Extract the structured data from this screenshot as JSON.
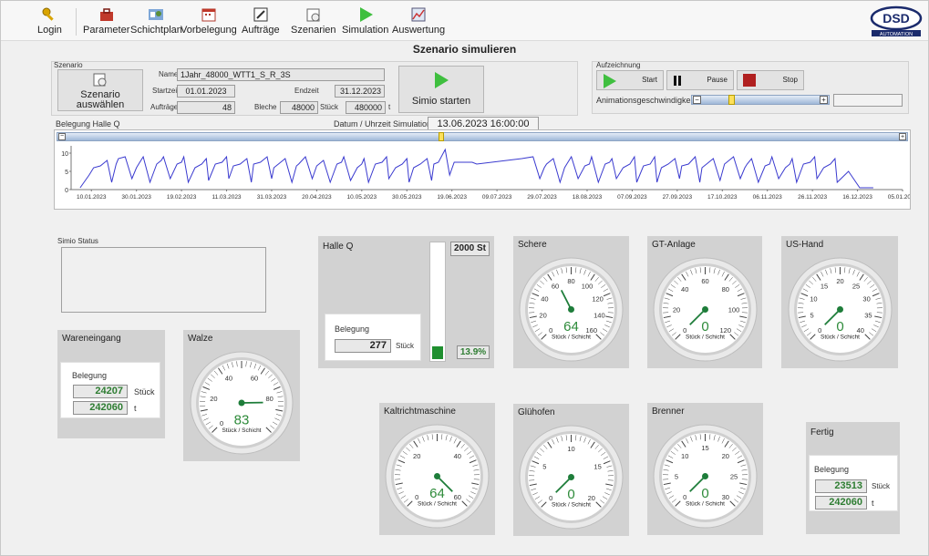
{
  "toolbar": {
    "login": "Login",
    "parameter": "Parameter",
    "schichtplan": "Schichtplan",
    "vorbelegung": "Vorbelegung",
    "auftraege": "Aufträge",
    "szenarien": "Szenarien",
    "simulation": "Simulation",
    "auswertung": "Auswertung"
  },
  "logo": {
    "top": "DSD",
    "bottom": "AUTOMATION"
  },
  "page_title": "Szenario simulieren",
  "szenario": {
    "group_label": "Szenario",
    "select_button": "Szenario auswählen",
    "name_label": "Name",
    "name_value": "1Jahr_48000_WTT1_S_R_3S",
    "startzeit_label": "Startzeit",
    "startzeit_value": "01.01.2023",
    "endzeit_label": "Endzeit",
    "endzeit_value": "31.12.2023",
    "auftraege_label": "Aufträge",
    "auftraege_value": "48",
    "bleche_label": "Bleche",
    "bleche_value": "48000",
    "stueck_label": "Stück",
    "t_value": "480000",
    "t_unit": "t",
    "start_button": "Simio starten"
  },
  "aufzeichnung": {
    "group_label": "Aufzeichnung",
    "start": "Start",
    "pause": "Pause",
    "stop": "Stop",
    "anim_label": "Animationsgeschwindigkeit"
  },
  "chart_header": {
    "title": "Belegung Halle Q",
    "datetime_label": "Datum / Uhrzeit Simulation",
    "datetime_value": "13.06.2023 16:00:00"
  },
  "chart_data": {
    "type": "line",
    "title": "Belegung Halle Q",
    "ylim": [
      0,
      12
    ],
    "yticks": [
      "10",
      "5",
      "0"
    ],
    "xticks": [
      "10.01.2023",
      "30.01.2023",
      "19.02.2023",
      "11.03.2023",
      "31.03.2023",
      "20.04.2023",
      "10.05.2023",
      "30.05.2023",
      "19.06.2023",
      "09.07.2023",
      "29.07.2023",
      "18.08.2023",
      "07.09.2023",
      "27.09.2023",
      "17.10.2023",
      "06.11.2023",
      "26.11.2023",
      "16.12.2023",
      "05.01.2024"
    ],
    "series": [
      {
        "color": "#3a3acf",
        "x_days": [
          4,
          8,
          10,
          13,
          16,
          18,
          20,
          21,
          24,
          27,
          29,
          30,
          32,
          35,
          38,
          40,
          41,
          44,
          47,
          49,
          50,
          52,
          55,
          58,
          60,
          61,
          64,
          67,
          69,
          70,
          72,
          75,
          78,
          80,
          81,
          84,
          87,
          89,
          90,
          92,
          95,
          98,
          100,
          101,
          104,
          107,
          109,
          110,
          112,
          115,
          118,
          120,
          121,
          124,
          127,
          129,
          130,
          132,
          135,
          138,
          140,
          141,
          144,
          147,
          149,
          150,
          152,
          155,
          158,
          160,
          161,
          163,
          166,
          168,
          170,
          172,
          175,
          178,
          180,
          200,
          205,
          208,
          210,
          211,
          214,
          217,
          219,
          220,
          222,
          225,
          228,
          230,
          231,
          234,
          237,
          239,
          240,
          242,
          245,
          248,
          250,
          251,
          254,
          257,
          259,
          260,
          262,
          265,
          268,
          270,
          271,
          274,
          277,
          279,
          280,
          282,
          285,
          288,
          290,
          291,
          294,
          297,
          299,
          300,
          302,
          305,
          308,
          310,
          311,
          314,
          317,
          319,
          320,
          322,
          325,
          328,
          330,
          331,
          334,
          337,
          339,
          340,
          345,
          350,
          352,
          353,
          356,
          360
        ],
        "y": [
          0.5,
          4,
          6,
          6.5,
          8,
          2,
          7,
          8.5,
          9,
          3,
          6,
          7,
          9,
          2,
          7,
          8,
          9,
          3,
          7,
          7.5,
          9,
          2,
          6,
          7,
          8.5,
          2.5,
          7,
          7.5,
          9,
          3,
          6.5,
          7,
          8.5,
          2,
          7,
          7.5,
          9,
          3,
          6,
          7,
          8.5,
          2,
          6.5,
          7,
          9,
          3,
          6.5,
          7,
          8,
          2,
          7,
          7.5,
          9,
          2.5,
          6,
          7,
          8.5,
          2,
          7,
          7.5,
          9,
          3,
          6,
          7,
          8.5,
          2,
          6,
          7,
          8.5,
          2.5,
          7,
          7.5,
          11,
          4,
          7.5,
          7.5,
          7.5,
          7.5,
          7,
          8.5,
          9,
          3,
          6,
          7,
          8.5,
          2,
          6,
          7,
          9,
          3,
          6.5,
          7,
          9,
          2,
          7,
          7.5,
          8.5,
          3,
          6,
          7,
          9,
          2,
          6.5,
          7,
          9,
          2,
          6,
          7,
          8.5,
          3,
          6.5,
          7,
          9,
          2,
          6,
          7,
          8.5,
          2.5,
          7,
          7.5,
          9,
          3,
          6,
          7,
          8.5,
          2,
          6.5,
          7,
          9,
          3,
          6,
          7,
          8.5,
          2,
          7,
          7.5,
          9,
          3,
          6,
          7,
          8.5,
          2,
          5,
          0.5,
          0.5,
          0.5,
          0.5
        ]
      }
    ]
  },
  "simio_status": {
    "label": "Simio Status"
  },
  "wareneingang": {
    "title": "Wareneingang",
    "belegung": "Belegung",
    "stueck_value": "24207",
    "stueck_unit": "Stück",
    "t_value": "242060",
    "t_unit": "t"
  },
  "halle_q": {
    "title": "Halle Q",
    "capacity": "2000 St",
    "belegung": "Belegung",
    "value": "277",
    "unit": "Stück",
    "percent": "13.9%",
    "fill_fraction": 0.139
  },
  "fertig": {
    "title": "Fertig",
    "belegung": "Belegung",
    "stueck_value": "23513",
    "stueck_unit": "Stück",
    "t_value": "242060",
    "t_unit": "t"
  },
  "gauges": {
    "walze": {
      "title": "Walze",
      "value": "83",
      "max": 100,
      "unit": "Stück / Schicht",
      "ticks": [
        "0",
        "20",
        "40",
        "60",
        "80"
      ]
    },
    "schere": {
      "title": "Schere",
      "value": "64",
      "max": 160,
      "unit": "Stück / Schicht",
      "ticks": [
        "0",
        "20",
        "40",
        "60",
        "80",
        "100",
        "120",
        "140",
        "160"
      ]
    },
    "gt_anlage": {
      "title": "GT-Anlage",
      "value": "0",
      "max": 120,
      "unit": "Stück / Schicht",
      "ticks": [
        "0",
        "20",
        "40",
        "60",
        "80",
        "100",
        "120"
      ]
    },
    "us_hand": {
      "title": "US-Hand",
      "value": "0",
      "max": 40,
      "unit": "Stück / Schicht",
      "ticks": [
        "0",
        "5",
        "10",
        "15",
        "20",
        "25",
        "30",
        "35",
        "40"
      ]
    },
    "kaltrichtmaschine": {
      "title": "Kaltrichtmaschine",
      "value": "64",
      "max": 60,
      "unit": "Stück / Schicht",
      "ticks": [
        "0",
        "20",
        "40",
        "60"
      ]
    },
    "gluehofen": {
      "title": "Glühofen",
      "value": "0",
      "max": 20,
      "unit": "Stück / Schicht",
      "ticks": [
        "0",
        "5",
        "10",
        "15",
        "20"
      ]
    },
    "brenner": {
      "title": "Brenner",
      "value": "0",
      "max": 30,
      "unit": "Stück / Schicht",
      "ticks": [
        "0",
        "5",
        "10",
        "15",
        "20",
        "25",
        "30"
      ]
    }
  }
}
